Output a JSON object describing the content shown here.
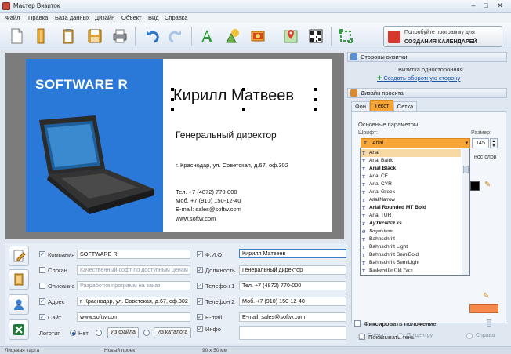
{
  "window": {
    "title": "Мастер Визиток"
  },
  "menu": [
    "Файл",
    "Правка",
    "База данных",
    "Дизайн",
    "Объект",
    "Вид",
    "Справка"
  ],
  "promo": {
    "line1": "Попробуйте программу для",
    "line2": "СОЗДАНИЯ КАЛЕНДАРЕЙ"
  },
  "card": {
    "company": "SOFTWARE R",
    "name": "Кирилл Матвеев",
    "position": "Генеральный директор",
    "address": "г. Краснодар, ул. Советская, д.67, оф.302",
    "phone": "Тел. +7 (4872) 770-000",
    "mobile": "Моб. +7 (910) 150-12-40",
    "email": "E-mail: sales@softw.com",
    "website": "www.softw.com"
  },
  "form": {
    "company_label": "Компания",
    "company_value": "SOFTWARE R",
    "slogan_label": "Слоган",
    "slogan_placeholder": "Качественный софт по доступным ценам",
    "description_label": "Описание",
    "description_placeholder": "Разработка программ на заказ",
    "address_label": "Адрес",
    "address_value": "г. Краснодар, ул. Советская, д.67, оф.302",
    "site_label": "Сайт",
    "site_value": "www.softw.com",
    "logo_label": "Логотип",
    "logo_none": "Нет",
    "logo_from_file": "Из файла",
    "logo_from_catalog": "Из каталога",
    "fio_label": "Ф.И.О.",
    "fio_value": "Кирилл Матвеев",
    "position_label": "Должность",
    "position_value": "Генеральный директор",
    "phone1_label": "Телефон 1",
    "phone1_value": "Тел. +7 (4872) 770-000",
    "phone2_label": "Телефон 2",
    "phone2_value": "Моб. +7 (910) 150-12-40",
    "email_label": "E-mail",
    "email_value": "E-mail: sales@softw.com",
    "info_label": "Инфо"
  },
  "sides": {
    "header": "Стороны визитки",
    "info": "Визитка односторонняя.",
    "link": "Создать оборотную сторону"
  },
  "design": {
    "header": "Дизайн проекта",
    "tabs": [
      "Фон",
      "Текст",
      "Сетка"
    ],
    "group_title": "Основные параметры:",
    "font_label": "Шрифт:",
    "size_label": "Размер:",
    "font_value": "Arial",
    "size_value": "145",
    "partial_hint": "нос слов",
    "show_shadow": "Показывать тень",
    "fix_position": "Фиксировать положение",
    "align": [
      "Слева",
      "По центру",
      "Справа"
    ]
  },
  "font_list": [
    "Arial",
    "Arial Baltic",
    "Arial Black",
    "Arial CE",
    "Arial CYR",
    "Arial Greek",
    "Arial Narrow",
    "Arial Rounded MT Bold",
    "Arial TUR",
    "AyTkcNS9.ks",
    "Bagatsitem",
    "Bahnschrift",
    "Bahnschrift Light",
    "Bahnschrift SemiBold",
    "Bahnschrift SemiLight",
    "Baskerville Old Face"
  ],
  "status": {
    "mode": "Лицевая карта",
    "project": "Новый проект",
    "size": "90 x 50 мм"
  },
  "colors": {
    "card_blue": "#2a78d8",
    "active_tab": "#f7a536",
    "swatch": "#f58a4a",
    "link": "#1a55a8"
  }
}
